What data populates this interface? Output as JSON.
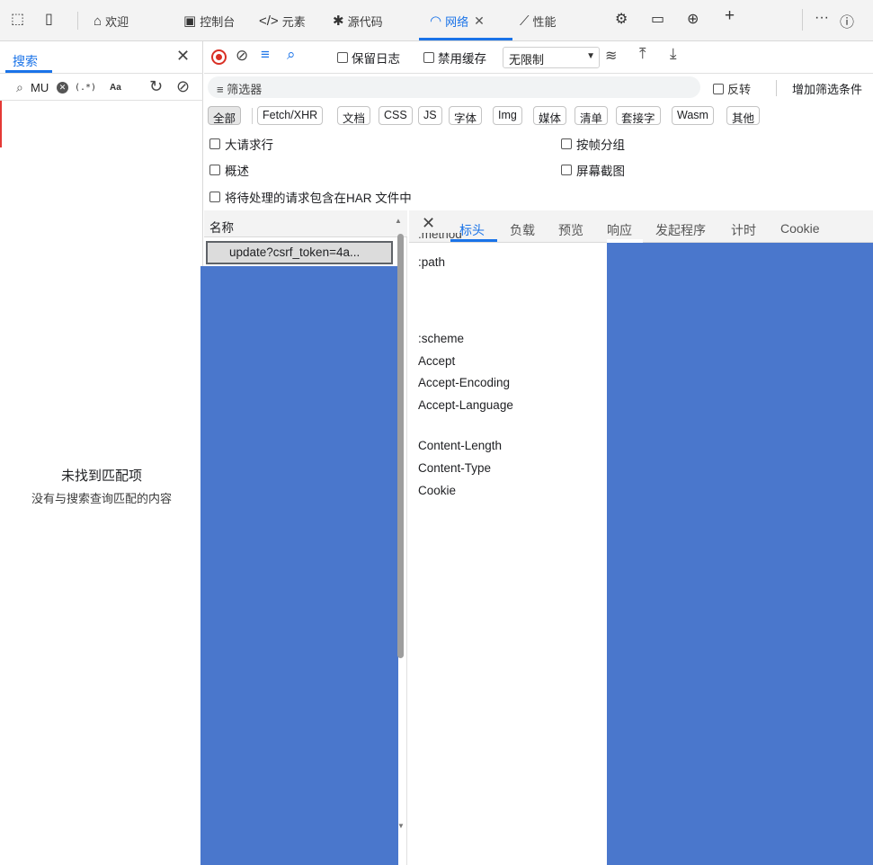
{
  "tabs": [
    {
      "label": "欢迎",
      "icon": "home-icon"
    },
    {
      "label": "控制台",
      "icon": "console-icon"
    },
    {
      "label": "元素",
      "icon": "code-icon"
    },
    {
      "label": "源代码",
      "icon": "bug-icon"
    },
    {
      "label": "网络",
      "icon": "wifi-icon",
      "active": true
    },
    {
      "label": "性能",
      "icon": "performance-icon"
    }
  ],
  "search": {
    "tab_label": "搜索",
    "query": "MU",
    "regex_label": "(.*)",
    "case_label": "Aa",
    "empty_title": "未找到匹配项",
    "empty_subtitle": "没有与搜索查询匹配的内容"
  },
  "toolbar": {
    "preserve_log": "保留日志",
    "disable_cache": "禁用缓存",
    "throttle": "无限制"
  },
  "filter": {
    "placeholder": "筛选器",
    "invert": "反转",
    "more_filters": "增加筛选条件"
  },
  "types": [
    "全部",
    "Fetch/XHR",
    "文档",
    "CSS",
    "JS",
    "字体",
    "Img",
    "媒体",
    "清单",
    "套接字",
    "Wasm",
    "其他"
  ],
  "options": {
    "large_rows": "大请求行",
    "overview": "概述",
    "include_pending": "将待处理的请求包含在HAR 文件中",
    "group_by_frame": "按帧分组",
    "screenshots": "屏幕截图"
  },
  "list": {
    "name_header": "名称",
    "selected_request": "update?csrf_token=4a..."
  },
  "details": {
    "tabs": [
      "标头",
      "负载",
      "预览",
      "响应",
      "发起程序",
      "计时",
      "Cookie"
    ],
    "active_tab": "标头",
    "headers": [
      ":method",
      ":path",
      ":scheme",
      "Accept",
      "Accept-Encoding",
      "Accept-Language",
      "Content-Length",
      "Content-Type",
      "Cookie"
    ]
  },
  "colors": {
    "accent": "#1a73e8",
    "redaction": "#4a77cc",
    "record": "#d93025"
  }
}
